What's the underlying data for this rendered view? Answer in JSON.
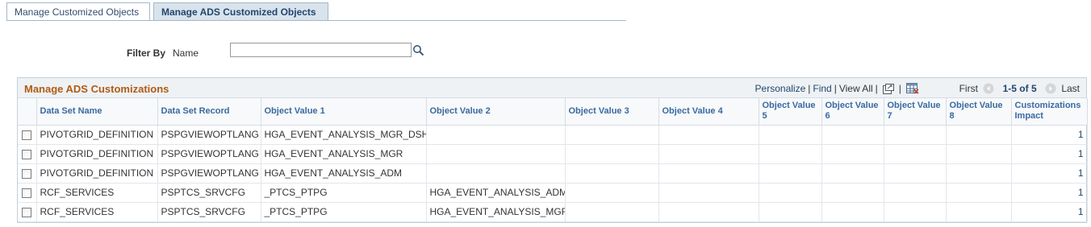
{
  "tabs": [
    {
      "label": "Manage Customized Objects"
    },
    {
      "label": "Manage ADS Customized Objects"
    }
  ],
  "filter": {
    "label": "Filter By",
    "field": "Name",
    "value": ""
  },
  "grid": {
    "title": "Manage ADS Customizations",
    "nav": {
      "personalize": "Personalize",
      "find": "Find",
      "view_all": "View All",
      "first": "First",
      "range": "1-5 of 5",
      "last": "Last"
    },
    "columns": [
      "Data Set Name",
      "Data Set Record",
      "Object Value 1",
      "Object Value 2",
      "Object Value 3",
      "Object Value 4",
      "Object Value 5",
      "Object Value 6",
      "Object Value 7",
      "Object Value 8",
      "Customizations Impact"
    ],
    "rows": [
      {
        "c": [
          "PIVOTGRID_DEFINITION",
          "PSPGVIEWOPTLANG",
          "HGA_EVENT_ANALYSIS_MGR_DSH",
          "",
          "",
          "",
          "",
          "",
          "",
          "",
          "1"
        ]
      },
      {
        "c": [
          "PIVOTGRID_DEFINITION",
          "PSPGVIEWOPTLANG",
          "HGA_EVENT_ANALYSIS_MGR",
          "",
          "",
          "",
          "",
          "",
          "",
          "",
          "1"
        ]
      },
      {
        "c": [
          "PIVOTGRID_DEFINITION",
          "PSPGVIEWOPTLANG",
          "HGA_EVENT_ANALYSIS_ADM",
          "",
          "",
          "",
          "",
          "",
          "",
          "",
          "1"
        ]
      },
      {
        "c": [
          "RCF_SERVICES",
          "PSPTCS_SRVCFG",
          "_PTCS_PTPG",
          "HGA_EVENT_ANALYSIS_ADM",
          "",
          "",
          "",
          "",
          "",
          "",
          "1"
        ]
      },
      {
        "c": [
          "RCF_SERVICES",
          "PSPTCS_SRVCFG",
          "_PTCS_PTPG",
          "HGA_EVENT_ANALYSIS_MGR",
          "",
          "",
          "",
          "",
          "",
          "",
          "1"
        ]
      }
    ]
  },
  "icons": {
    "search": "search-icon",
    "zoom": "new-window-icon",
    "download": "download-to-excel-icon",
    "prev": "previous-arrow-icon",
    "next": "next-arrow-icon"
  }
}
